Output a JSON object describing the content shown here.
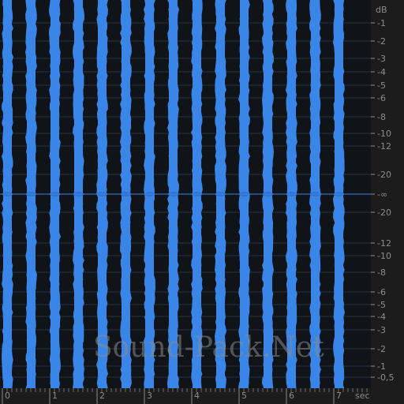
{
  "waveform_editor": {
    "db_unit": "dB",
    "time_unit": "sec",
    "watermark": "Sound-Pack.Net",
    "colors": {
      "background": "#101318",
      "waveform": "#3a86e8",
      "grid": "#2a3040",
      "ruler": "#1c1c1c",
      "ruler_text": "#8c8c8c"
    },
    "time_axis": {
      "labels": [
        "0",
        "1",
        "2",
        "3",
        "4",
        "5",
        "6",
        "7"
      ],
      "seconds": [
        0,
        1,
        2,
        3,
        4,
        5,
        6,
        7
      ],
      "end_seconds": 7.4
    },
    "db_scale": {
      "upper": [
        "-1",
        "-2",
        "-3",
        "-4",
        "-5",
        "-6",
        "-8",
        "-10",
        "-12",
        "-20"
      ],
      "middle": "-∞",
      "lower": [
        "-20",
        "-12",
        "-10",
        "-8",
        "-6",
        "-5",
        "-4",
        "-3",
        "-2",
        "-1",
        "-0,5"
      ]
    },
    "waveform": {
      "bursts_per_second": 2,
      "burst_count": 15
    }
  }
}
